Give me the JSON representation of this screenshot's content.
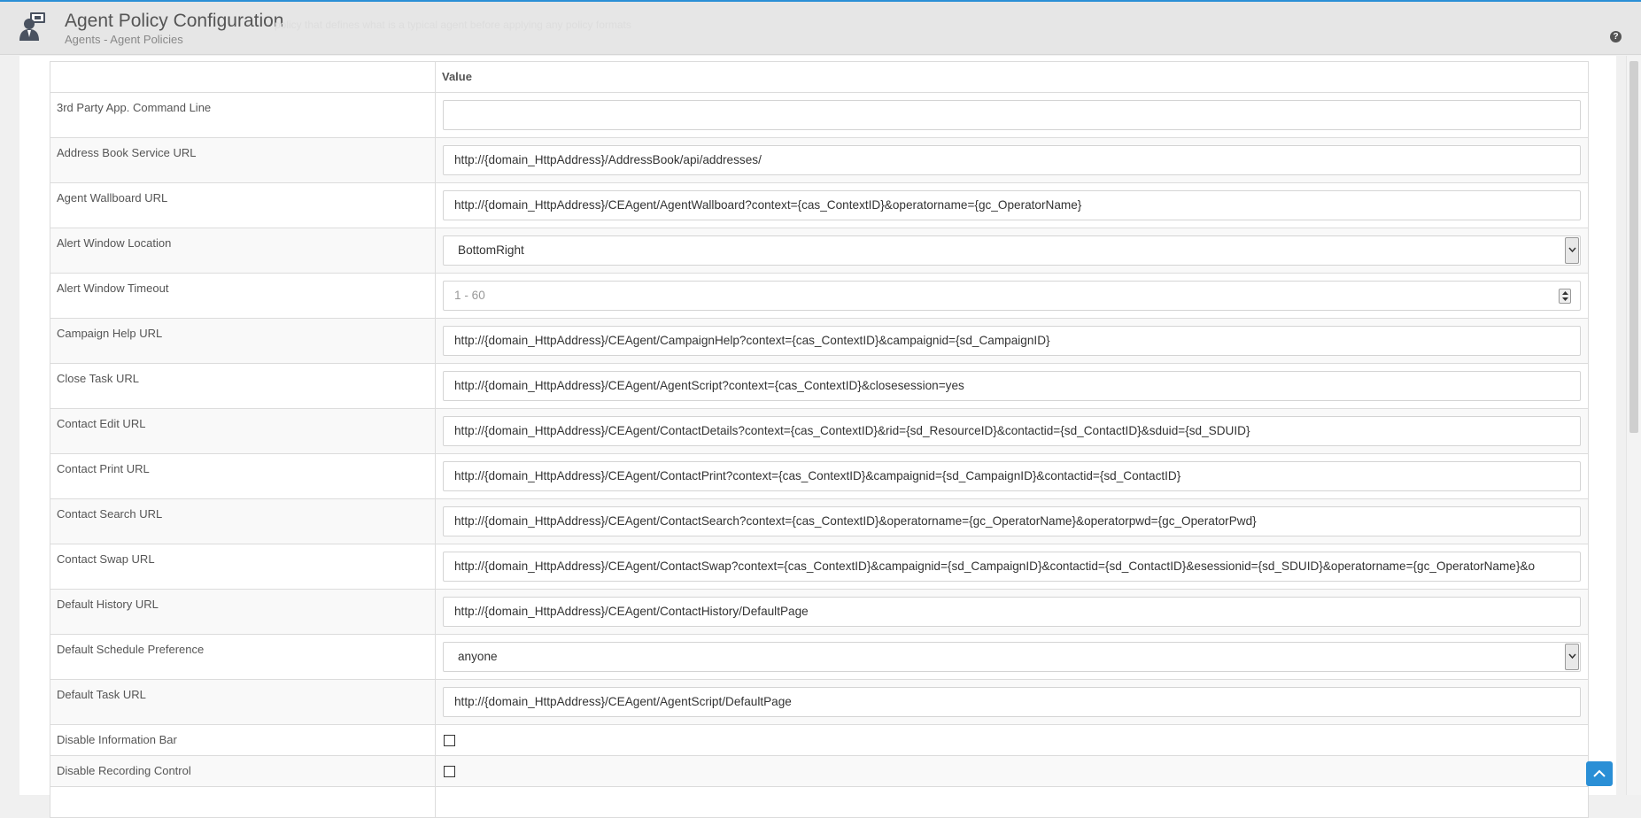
{
  "header": {
    "title": "Agent Policy Configuration",
    "breadcrumb": "Agents - Agent Policies",
    "ghost_text": "policy that defines what is a typical agent before applying any policy formats",
    "help_label": "?"
  },
  "table": {
    "col_name": "",
    "col_value": "Value",
    "rows": [
      {
        "label": "3rd Party App. Command Line",
        "type": "text",
        "value": ""
      },
      {
        "label": "Address Book Service URL",
        "type": "text",
        "value": "http://{domain_HttpAddress}/AddressBook/api/addresses/"
      },
      {
        "label": "Agent Wallboard URL",
        "type": "text",
        "value": "http://{domain_HttpAddress}/CEAgent/AgentWallboard?context={cas_ContextID}&operatorname={gc_OperatorName}"
      },
      {
        "label": "Alert Window Location",
        "type": "select",
        "value": "BottomRight"
      },
      {
        "label": "Alert Window Timeout",
        "type": "number",
        "placeholder": "1 - 60"
      },
      {
        "label": "Campaign Help URL",
        "type": "text",
        "value": "http://{domain_HttpAddress}/CEAgent/CampaignHelp?context={cas_ContextID}&campaignid={sd_CampaignID}"
      },
      {
        "label": "Close Task URL",
        "type": "text",
        "value": "http://{domain_HttpAddress}/CEAgent/AgentScript?context={cas_ContextID}&closesession=yes"
      },
      {
        "label": "Contact Edit URL",
        "type": "text",
        "value": "http://{domain_HttpAddress}/CEAgent/ContactDetails?context={cas_ContextID}&rid={sd_ResourceID}&contactid={sd_ContactID}&sduid={sd_SDUID}"
      },
      {
        "label": "Contact Print URL",
        "type": "text",
        "value": "http://{domain_HttpAddress}/CEAgent/ContactPrint?context={cas_ContextID}&campaignid={sd_CampaignID}&contactid={sd_ContactID}"
      },
      {
        "label": "Contact Search URL",
        "type": "text",
        "value": "http://{domain_HttpAddress}/CEAgent/ContactSearch?context={cas_ContextID}&operatorname={gc_OperatorName}&operatorpwd={gc_OperatorPwd}"
      },
      {
        "label": "Contact Swap URL",
        "type": "text",
        "value": "http://{domain_HttpAddress}/CEAgent/ContactSwap?context={cas_ContextID}&campaignid={sd_CampaignID}&contactid={sd_ContactID}&esessionid={sd_SDUID}&operatorname={gc_OperatorName}&o"
      },
      {
        "label": "Default History URL",
        "type": "text",
        "value": "http://{domain_HttpAddress}/CEAgent/ContactHistory/DefaultPage"
      },
      {
        "label": "Default Schedule Preference",
        "type": "select",
        "value": "anyone"
      },
      {
        "label": "Default Task URL",
        "type": "text",
        "value": "http://{domain_HttpAddress}/CEAgent/AgentScript/DefaultPage"
      },
      {
        "label": "Disable Information Bar",
        "type": "checkbox",
        "checked": false
      },
      {
        "label": "Disable Recording Control",
        "type": "checkbox",
        "checked": false
      }
    ]
  },
  "icons": {
    "logo": "agent-monitor-icon",
    "help": "help-icon",
    "scroll_top": "chevron-up-icon"
  },
  "colors": {
    "accent": "#2a8fd6",
    "header_bg": "#e6e6e6"
  }
}
